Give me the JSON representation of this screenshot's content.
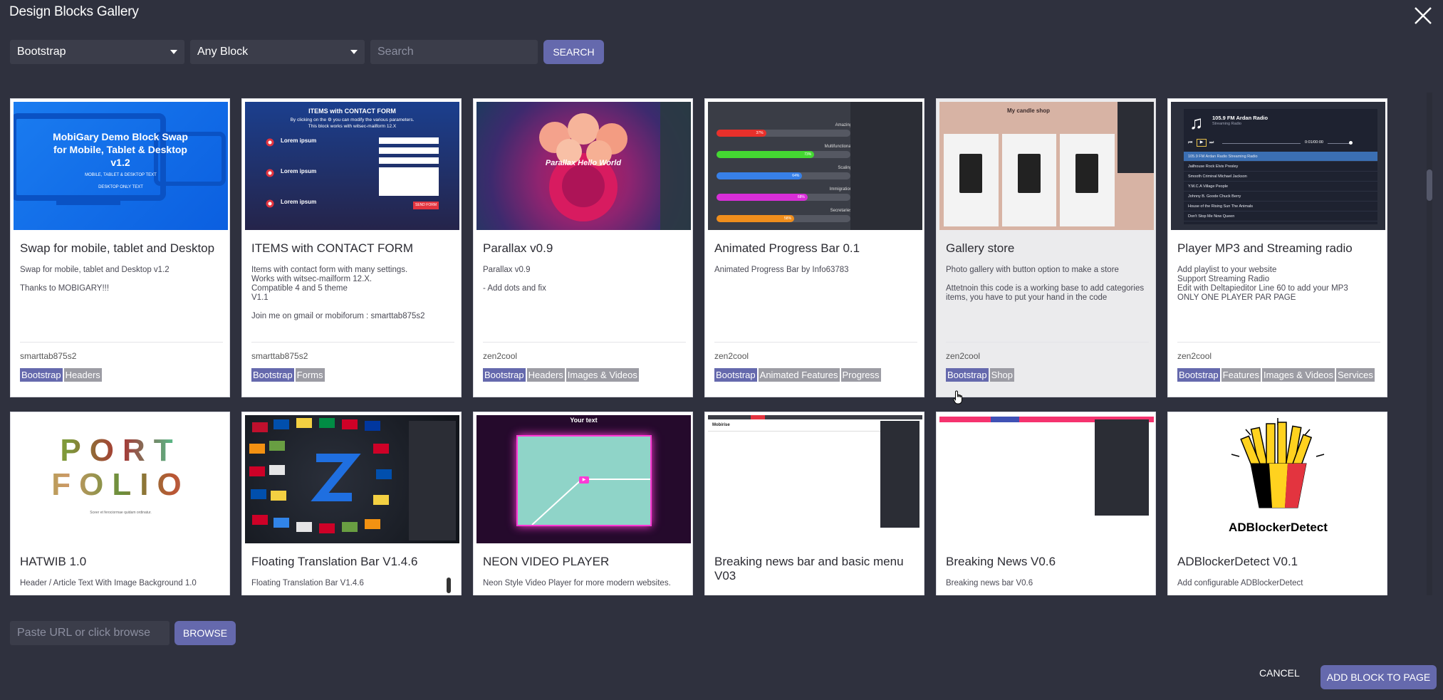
{
  "window": {
    "title": "Design Blocks Gallery",
    "close_icon": "close-icon"
  },
  "filters": {
    "framework": "Bootstrap",
    "block_type": "Any Block",
    "search_placeholder": "Search",
    "search_button": "SEARCH"
  },
  "cards": [
    {
      "title": "Swap for mobile, tablet and Desktop",
      "description": "Swap for mobile, tablet and Desktop v1.2\n\nThanks to MOBIGARY!!!",
      "author": "smarttab875s2",
      "tags": [
        "Bootstrap",
        "Headers"
      ],
      "thumb": {
        "heading": "MobiGary Demo Block Swap for Mobile, Tablet & Desktop v1.2",
        "sub1": "MOBILE, TABLET & DESKTOP TEXT",
        "sub2": "DESKTOP ONLY TEXT"
      }
    },
    {
      "title": "ITEMS with CONTACT FORM",
      "description": "Items with contact form with many settings.\nWorks with witsec-mailform 12.X.\nCompatible 4 and 5 theme\nV1.1\n\nJoin me on gmail or mobiforum : smarttab875s2",
      "author": "smarttab875s2",
      "tags": [
        "Bootstrap",
        "Forms"
      ],
      "thumb": {
        "heading": "ITEMS with CONTACT FORM",
        "sub1": "By clicking on the ⚙ you can modify the various parameters.",
        "sub2": "This block works with witsec-mailform 12.X",
        "item_label": "Lorem ipsum",
        "button": "SEND FORM"
      }
    },
    {
      "title": "Parallax v0.9",
      "description": "Parallax v0.9\n\n- Add dots and fix",
      "author": "zen2cool",
      "tags": [
        "Bootstrap",
        "Headers",
        "Images & Videos"
      ],
      "thumb": {
        "overlay": "Parallax Hello World"
      }
    },
    {
      "title": "Animated Progress Bar 0.1",
      "description": "Animated Progress Bar by Info63783",
      "author": "zen2cool",
      "tags": [
        "Bootstrap",
        "Animated Features",
        "Progress"
      ],
      "thumb": {
        "bars": [
          {
            "label": "Amazing",
            "value": 0.37,
            "color": "#e8302b"
          },
          {
            "label": "Multifunctional",
            "value": 0.73,
            "color": "#44d832"
          },
          {
            "label": "Scaling",
            "value": 0.64,
            "color": "#3780e8"
          },
          {
            "label": "Immigration",
            "value": 0.68,
            "color": "#d82ed8"
          },
          {
            "label": "Secretaries",
            "value": 0.58,
            "color": "#f08e1c"
          }
        ]
      }
    },
    {
      "title": "Gallery store",
      "description": "Photo gallery with button option to make a store\n\nAttetnoin this code is a working base to add categories items, you have to put your hand in the code",
      "author": "zen2cool",
      "tags": [
        "Bootstrap",
        "Shop"
      ],
      "thumb": {
        "heading": "My candle shop"
      }
    },
    {
      "title": "Player MP3 and Streaming radio",
      "description": "Add playlist to your website\nSupport Streaming Radio\nEdit with Deltapieditor Line 60 to add your MP3\nONLY ONE PLAYER PAR PAGE",
      "author": "zen2cool",
      "tags": [
        "Bootstrap",
        "Features",
        "Images & Videos",
        "Services"
      ],
      "thumb": {
        "station": "105.9 FM Ardan Radio",
        "sub": "Streaming Radio",
        "time": "0:01/00:00",
        "playlist": [
          "105.9 FM Ardan Radio  Streaming Radio",
          "Jailhouse Rock  Elvis Presley",
          "Smooth Criminal  Michael Jackson",
          "Y.M.C.A  Village People",
          "Johnny B. Goode  Chuck Berry",
          "House of the Rising Sun  The Animals",
          "Don't Stop Me Now  Queen"
        ]
      }
    },
    {
      "title": "HATWIB 1.0",
      "description": "Header / Article Text With Image Background 1.0",
      "author": "",
      "tags": [],
      "thumb": {
        "line1": "PORT",
        "line2": "FOLIO",
        "sub": "Sceer et ferociormae quidam ordinatur."
      }
    },
    {
      "title": "Floating Translation Bar V1.4.6",
      "description": "Floating Translation Bar V1.4.6",
      "author": "",
      "tags": [],
      "thumb": {}
    },
    {
      "title": "NEON VIDEO PLAYER",
      "description": "Neon Style Video Player for more modern websites.",
      "author": "",
      "tags": [],
      "thumb": {
        "heading": "Your text"
      }
    },
    {
      "title": "Breaking news bar and basic menu V03",
      "description": "",
      "author": "",
      "tags": [],
      "thumb": {
        "brand": "Mobirise"
      }
    },
    {
      "title": "Breaking News V0.6",
      "description": "Breaking news bar V0.6",
      "author": "",
      "tags": [],
      "thumb": {}
    },
    {
      "title": "ADBlockerDetect V0.1",
      "description": "Add configurable ADBlockerDetect",
      "author": "",
      "tags": [],
      "thumb": {
        "label": "ADBlockerDetect"
      }
    }
  ],
  "footer": {
    "url_placeholder": "Paste URL or click browse",
    "browse_button": "BROWSE",
    "cancel_button": "CANCEL",
    "add_button": "ADD BLOCK TO PAGE"
  },
  "colors": {
    "background": "#2f313e",
    "accent": "#6569ad",
    "tag_secondary": "#9c9ca4"
  }
}
